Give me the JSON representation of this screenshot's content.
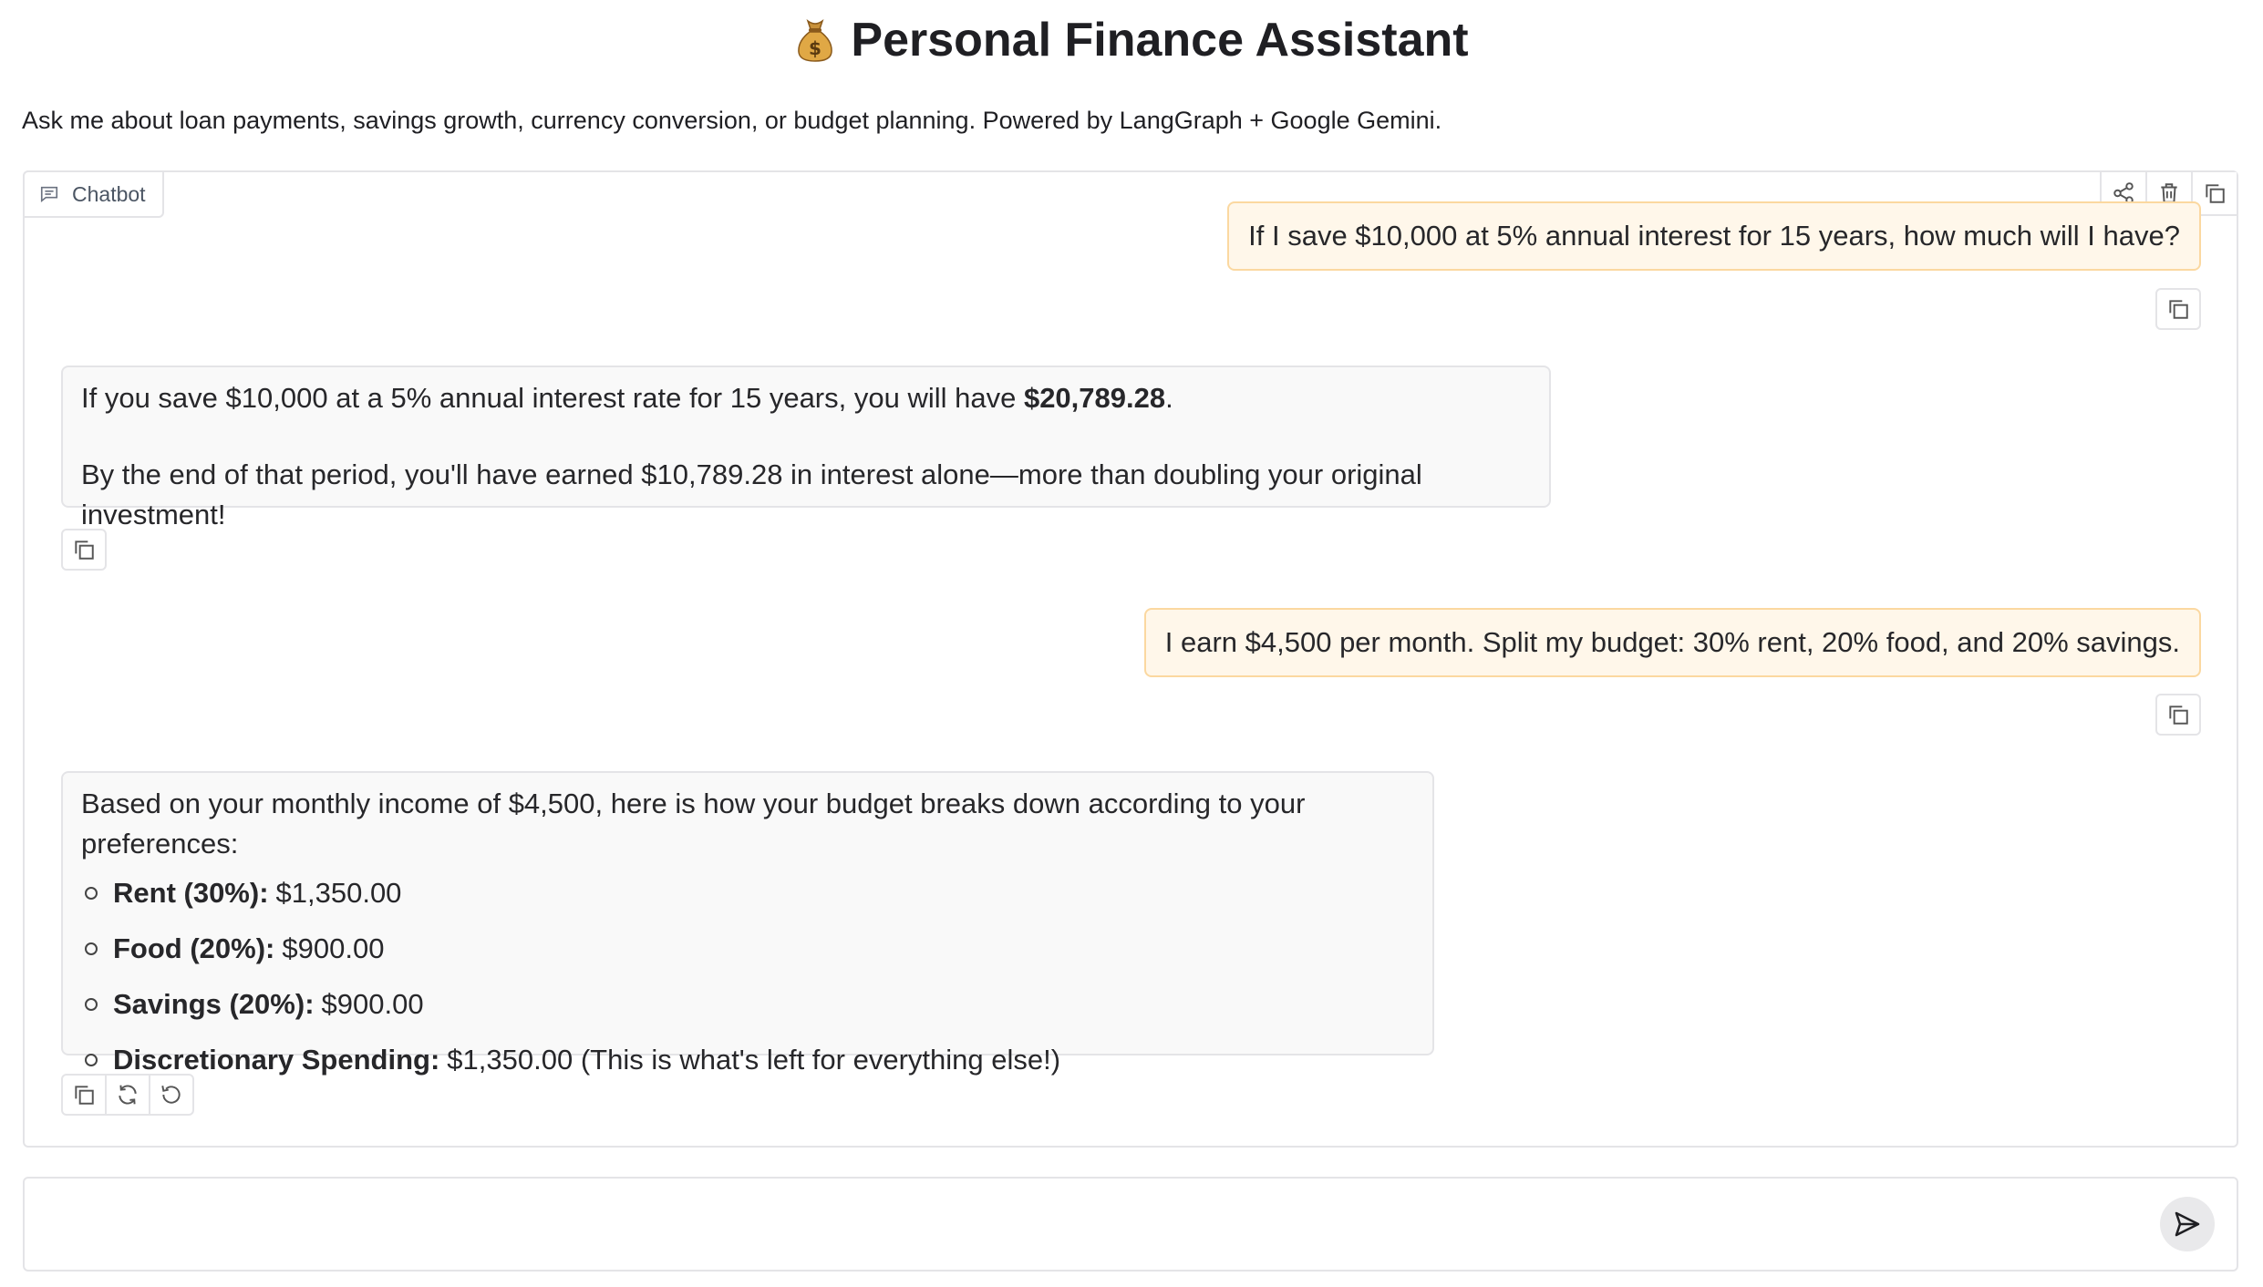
{
  "header": {
    "title": "Personal Finance Assistant",
    "title_icon": "money-bag-icon",
    "description": "Ask me about loan payments, savings growth, currency conversion, or budget planning. Powered by LangGraph + Google Gemini."
  },
  "chatbot": {
    "label": "Chatbot",
    "tools": [
      "share-icon",
      "trash-icon",
      "copy-icon"
    ],
    "messages": [
      {
        "role": "user",
        "text": "If I save $10,000 at 5% annual interest for 15 years, how much will I have?"
      },
      {
        "role": "assistant",
        "line1_prefix": "If you save $10,000 at a 5% annual interest rate for 15 years, you will have ",
        "line1_bold": "$20,789.28",
        "line1_suffix": ".",
        "line2": "By the end of that period, you'll have earned $10,789.28 in interest alone—more than doubling your original investment!"
      },
      {
        "role": "user",
        "text": "I earn $4,500 per month. Split my budget: 30% rent, 20% food, and 20% savings."
      },
      {
        "role": "assistant",
        "intro": "Based on your monthly income of $4,500, here is how your budget breaks down according to your preferences:",
        "items": [
          {
            "label": "Rent (30%):",
            "value": "$1,350.00"
          },
          {
            "label": "Food (20%):",
            "value": "$900.00"
          },
          {
            "label": "Savings (20%):",
            "value": "$900.00"
          },
          {
            "label": "Discretionary Spending:",
            "value": "$1,350.00 (This is what's left for everything else!)"
          }
        ]
      }
    ]
  },
  "input": {
    "value": "",
    "placeholder": ""
  },
  "colors": {
    "user_bubble_bg": "#fff7ea",
    "user_bubble_border": "#fbd8a0",
    "bot_bubble_bg": "#f9f9f9",
    "border": "#e4e4e7"
  }
}
